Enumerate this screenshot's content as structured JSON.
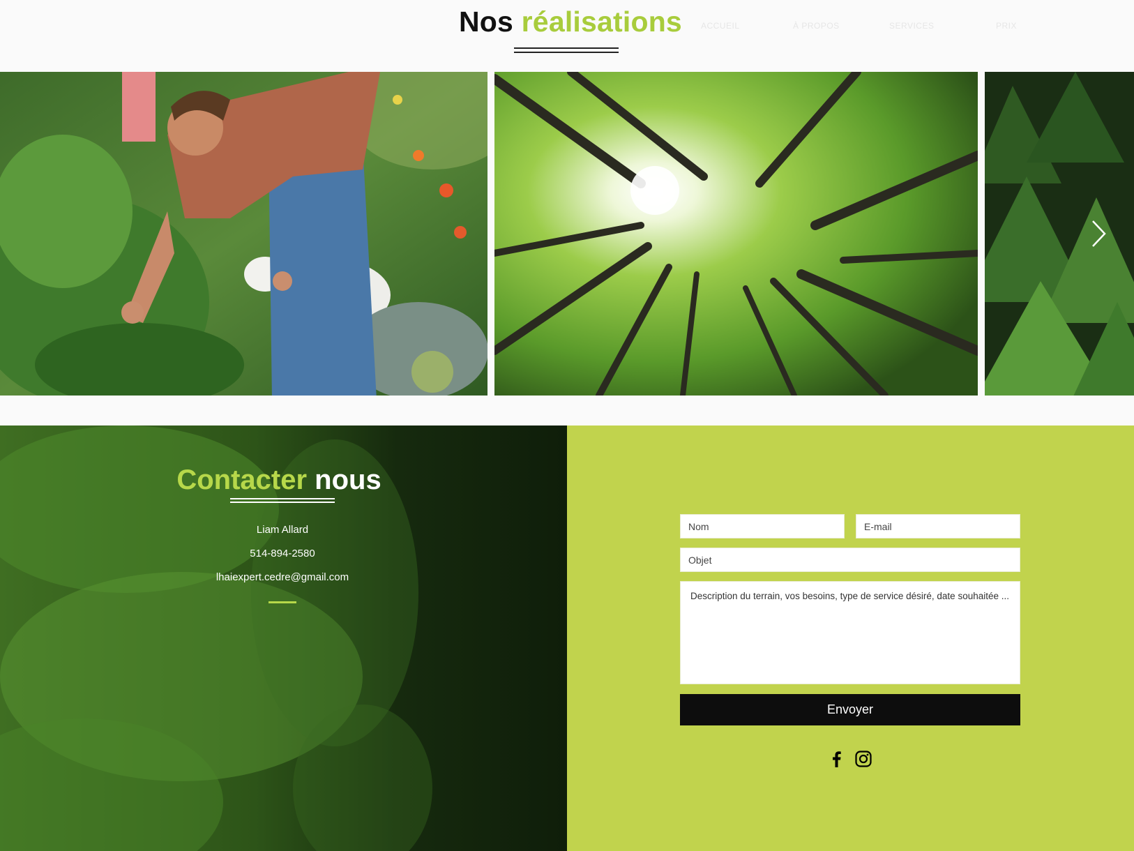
{
  "header": {
    "title_part1": "Nos",
    "title_part2": "réalisations",
    "nav": [
      "ACCUEIL",
      "À PROPOS",
      "SERVICES",
      "PRIX"
    ]
  },
  "gallery": {
    "images": [
      "gardener-photo",
      "forest-canopy-photo",
      "evergreen-photo"
    ],
    "next_icon": "chevron-right-icon"
  },
  "contact": {
    "title_part1": "Contacter",
    "title_part2": "nous",
    "name": "Liam Allard",
    "phone": "514-894-2580",
    "email": "lhaiexpert.cedre@gmail.com"
  },
  "form": {
    "name_placeholder": "Nom",
    "email_placeholder": "E-mail",
    "subject_placeholder": "Objet",
    "message_placeholder": "Description du terrain, vos besoins, type de service désiré, date souhaitée ...",
    "submit_label": "Envoyer"
  },
  "social": [
    "facebook-icon",
    "instagram-icon"
  ],
  "colors": {
    "accent_green": "#a8cc3c",
    "form_bg": "#c1d34d",
    "button_bg": "#0d0d0d"
  }
}
